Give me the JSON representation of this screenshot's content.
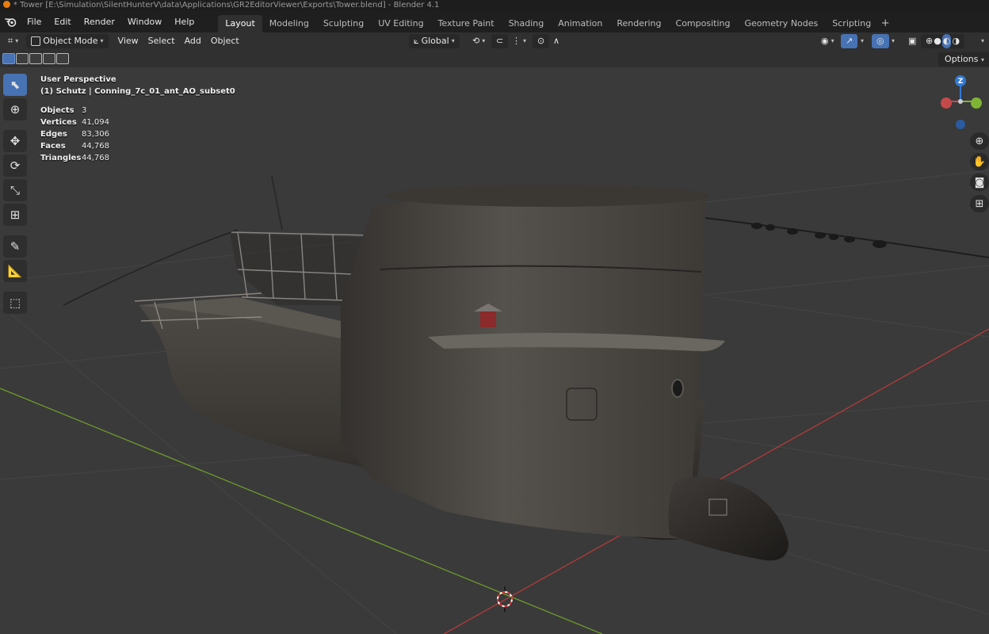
{
  "window": {
    "title": "* Tower [E:\\Simulation\\SilentHunterV\\data\\Applications\\GR2EditorViewer\\Exports\\Tower.blend] - Blender 4.1"
  },
  "menu": [
    "File",
    "Edit",
    "Render",
    "Window",
    "Help"
  ],
  "workspaces": [
    {
      "label": "Layout",
      "active": true
    },
    {
      "label": "Modeling"
    },
    {
      "label": "Sculpting"
    },
    {
      "label": "UV Editing"
    },
    {
      "label": "Texture Paint"
    },
    {
      "label": "Shading"
    },
    {
      "label": "Animation"
    },
    {
      "label": "Rendering"
    },
    {
      "label": "Compositing"
    },
    {
      "label": "Geometry Nodes"
    },
    {
      "label": "Scripting"
    }
  ],
  "viewport_header": {
    "mode": "Object Mode",
    "menus": [
      "View",
      "Select",
      "Add",
      "Object"
    ],
    "transform_orientation": "Global",
    "options_label": "Options"
  },
  "overlay": {
    "perspective": "User Perspective",
    "active_object": "(1) Schutz | Conning_7c_01_ant_AO_subset0",
    "stats": [
      {
        "label": "Objects",
        "value": "3"
      },
      {
        "label": "Vertices",
        "value": "41,094"
      },
      {
        "label": "Edges",
        "value": "83,306"
      },
      {
        "label": "Faces",
        "value": "44,768"
      },
      {
        "label": "Triangles",
        "value": "44,768"
      }
    ]
  },
  "gizmo": {
    "z_label": "Z"
  },
  "colors": {
    "accent": "#4772b3",
    "x_axis": "#c44949",
    "y_axis": "#7fb534",
    "z_axis": "#2f7ad6",
    "viewport_bg": "#3a3a3a"
  },
  "tools": [
    "select-box",
    "cursor",
    "move",
    "rotate",
    "scale",
    "transform",
    "annotate",
    "measure",
    "add-cube"
  ]
}
